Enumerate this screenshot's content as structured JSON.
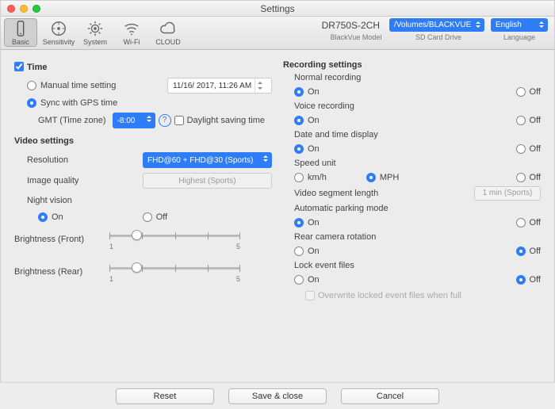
{
  "title": "Settings",
  "toolbar": {
    "items": [
      "Basic",
      "Sensitivity",
      "System",
      "Wi-Fi",
      "CLOUD"
    ],
    "selected": 0
  },
  "header": {
    "model": "DR750S-2CH",
    "drive": "/Volumes/BLACKVUE",
    "lang": "English",
    "lbl_model": "BlackVue Model",
    "lbl_drive": "SD Card Drive",
    "lbl_lang": "Language"
  },
  "left": {
    "time_hdr": "Time",
    "manual": "Manual time setting",
    "manual_val": "11/16/ 2017, 11:26 AM",
    "sync": "Sync with GPS time",
    "gmt_lbl": "GMT (Time zone)",
    "gmt_val": "-8:00",
    "dst": "Daylight saving time",
    "video_hdr": "Video settings",
    "res_lbl": "Resolution",
    "res_val": "FHD@60 + FHD@30 (Sports)",
    "iq_lbl": "Image quality",
    "iq_val": "Highest (Sports)",
    "nv_lbl": "Night vision",
    "bf_lbl": "Brightness (Front)",
    "br_lbl": "Brightness (Rear)",
    "slider_min": "1",
    "slider_max": "5"
  },
  "right": {
    "hdr": "Recording settings",
    "normal": "Normal recording",
    "voice": "Voice recording",
    "dt": "Date and time display",
    "speed": "Speed unit",
    "kmh": "km/h",
    "mph": "MPH",
    "seg": "Video segment length",
    "seg_val": "1 min (Sports)",
    "park": "Automatic parking mode",
    "rear": "Rear camera rotation",
    "lock": "Lock event files",
    "overwrite": "Overwrite locked event files when full"
  },
  "onoff": {
    "on": "On",
    "off": "Off"
  },
  "footer": {
    "reset": "Reset",
    "save": "Save & close",
    "cancel": "Cancel"
  }
}
